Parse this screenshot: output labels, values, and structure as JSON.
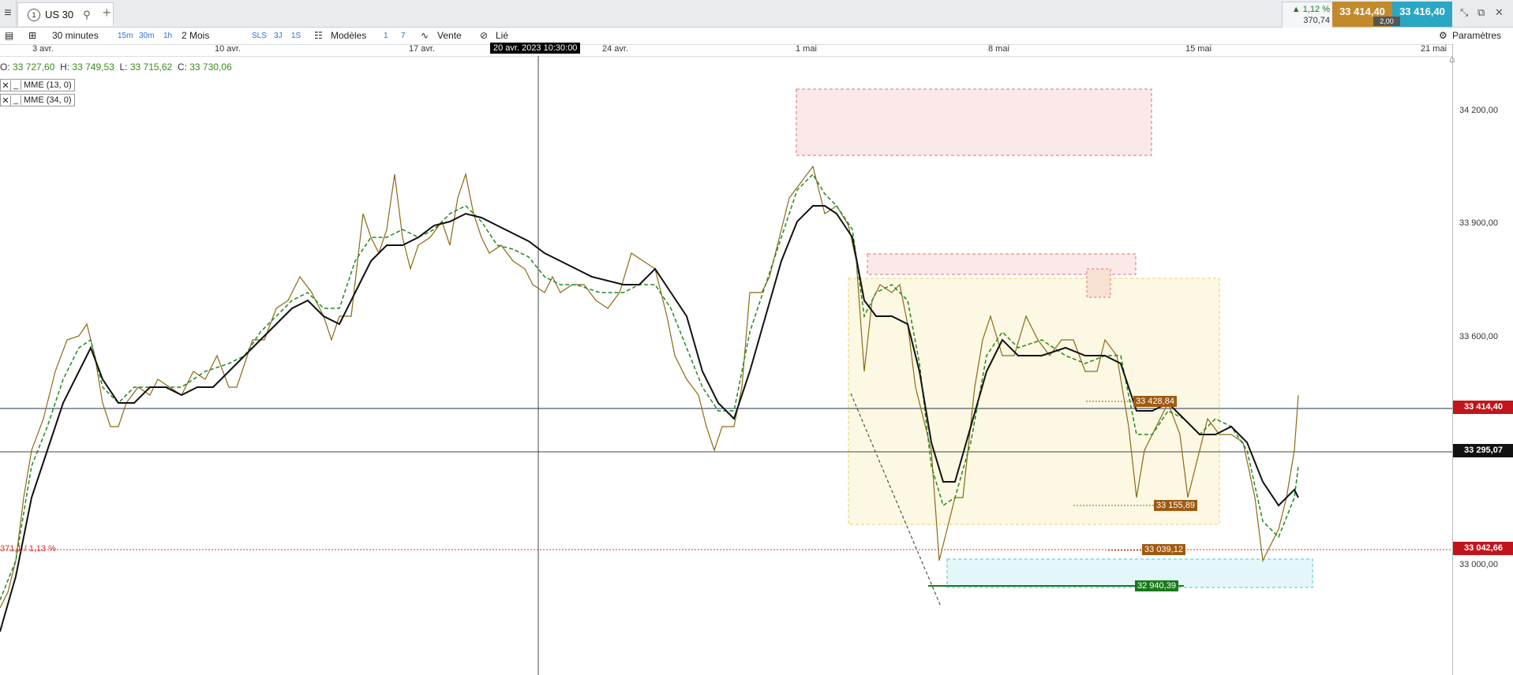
{
  "tabbar": {
    "menu_icon": "hamburger-icon",
    "tab_number": "1",
    "tab_title": "US 30",
    "search_icon": "search-icon",
    "add_tab": "+"
  },
  "quote": {
    "change_pct": "▲ 1,12 %",
    "change_pts": "370,74",
    "bid": "33 414,40",
    "ask": "33 416,40",
    "spread": "2,00",
    "bid_color": "#c28a2c",
    "ask_color": "#2aa7c4"
  },
  "toolbar": {
    "interval": "30 minutes",
    "i15": "15m",
    "i30": "30m",
    "i1h": "1h",
    "period": "2 Mois",
    "sls": "SLS",
    "p3j": "3J",
    "p1s": "1S",
    "models": "Modèles",
    "n1": "1",
    "n7": "7",
    "vente": "Vente",
    "lie": "Lié",
    "params": "Paramètres"
  },
  "axis": {
    "dates": [
      "3 avr.",
      "10 avr.",
      "17 avr.",
      "24 avr.",
      "1 mai",
      "8 mai",
      "15 mai",
      "21 mai"
    ],
    "crosshair_date": "20 avr. 2023 10:30:00"
  },
  "ohlc": {
    "o_label": "O:",
    "o": "33 727,60",
    "h_label": "H:",
    "h": "33 749,53",
    "l_label": "L:",
    "l": "33 715,62",
    "c_label": "C:",
    "c": "33 730,06"
  },
  "indicators": [
    {
      "name": "MME (13, 0)"
    },
    {
      "name": "MME (34, 0)"
    }
  ],
  "price_axis": {
    "labels": [
      "34 200,00",
      "33 900,00",
      "33 600,00",
      "33 000,00"
    ],
    "current": "33 414,40",
    "crosshair": "33 295,07",
    "ref": "33 042,66",
    "current_color": "#c0161b",
    "crosshair_color": "#111111",
    "ref_color": "#c0161b"
  },
  "tags": {
    "t1": "33 428,84",
    "t2": "33 155,89",
    "t3": "33 039,12",
    "t4": "32 940,39"
  },
  "pct_label": "371,1 / 1,13 %"
}
